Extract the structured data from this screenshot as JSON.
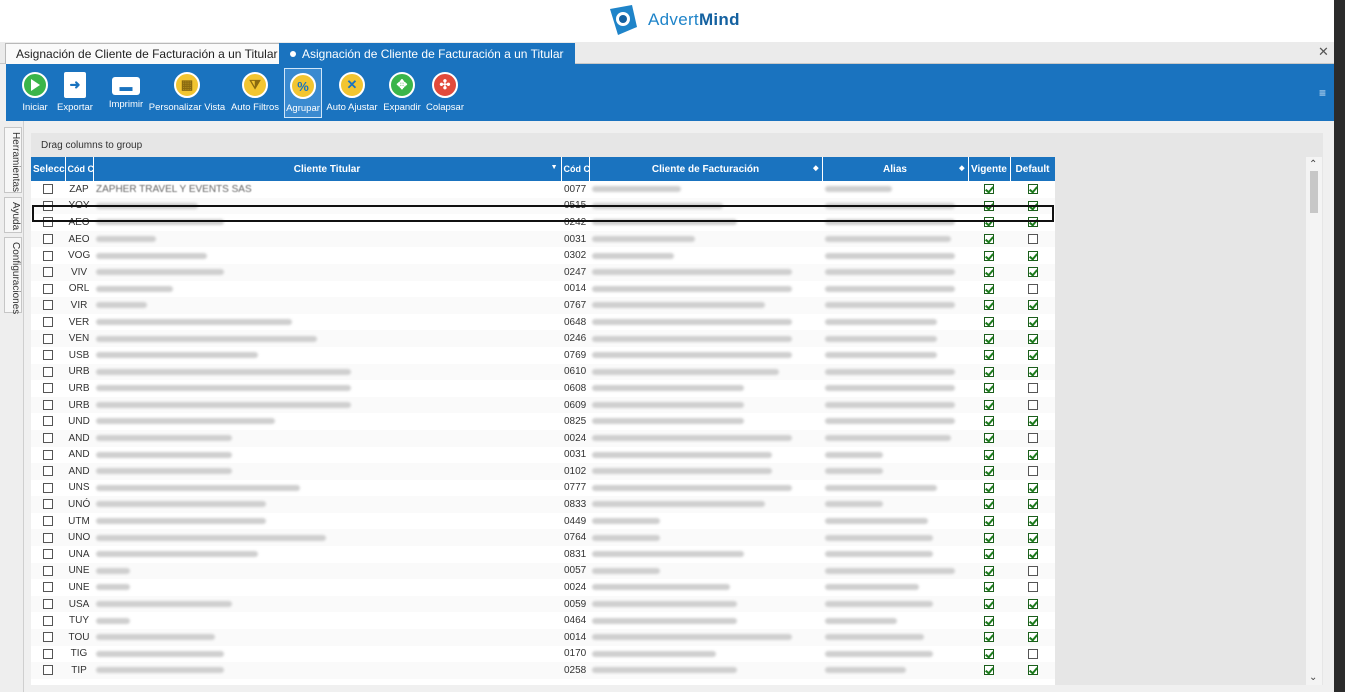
{
  "app": {
    "brand_part1": "Advert",
    "brand_part2": "Mind"
  },
  "tabs": [
    {
      "label": "Asignación de Cliente de Facturación a un Titular",
      "active": false
    },
    {
      "label": "Asignación de Cliente de Facturación a un Titular",
      "active": true
    }
  ],
  "toolbar": {
    "buttons": [
      {
        "label": "Iniciar",
        "icon": "play-icon",
        "color": "#3bb54a"
      },
      {
        "label": "Exportar",
        "icon": "export-icon",
        "color": "#ffffff"
      },
      {
        "label": "Imprimir",
        "icon": "printer-icon",
        "color": "#ffffff"
      },
      {
        "label": "Personalizar Vista",
        "icon": "grid-view-icon",
        "color": "#f2c531"
      },
      {
        "label": "Auto Filtros",
        "icon": "filter-icon",
        "color": "#f2c531"
      },
      {
        "label": "Agrupar",
        "icon": "group-icon",
        "color": "#f2c531"
      },
      {
        "label": "Auto Ajustar",
        "icon": "auto-fit-icon",
        "color": "#f2c531"
      },
      {
        "label": "Expandir",
        "icon": "expand-icon",
        "color": "#3bb54a"
      },
      {
        "label": "Colapsar",
        "icon": "collapse-icon",
        "color": "#e24a3b"
      }
    ]
  },
  "side_tabs": [
    "Herramientas",
    "Ayuda",
    "Configuraciones"
  ],
  "grid": {
    "group_hint": "Drag columns to group",
    "columns": [
      "Selecci",
      "Cód Cli Ti",
      "Cliente Titular",
      "Cód Cli F",
      "Cliente de Facturación",
      "Alias",
      "Vigente",
      "Default"
    ],
    "rows": [
      {
        "sel": false,
        "cod_tit": "ZAP",
        "titular": "ZAPHER TRAVEL Y EVENTS SAS",
        "cod_fac": "0077",
        "vig": true,
        "def": true
      },
      {
        "sel": false,
        "cod_tit": "YOY",
        "titular": "",
        "cod_fac": "0515",
        "vig": true,
        "def": true
      },
      {
        "sel": false,
        "cod_tit": "AEO",
        "titular": "",
        "cod_fac": "0242",
        "vig": true,
        "def": true
      },
      {
        "sel": false,
        "cod_tit": "AEO",
        "titular": "",
        "cod_fac": "0031",
        "vig": true,
        "def": false
      },
      {
        "sel": false,
        "cod_tit": "VOG",
        "titular": "",
        "cod_fac": "0302",
        "vig": true,
        "def": true
      },
      {
        "sel": false,
        "cod_tit": "VIV",
        "titular": "",
        "cod_fac": "0247",
        "vig": true,
        "def": true
      },
      {
        "sel": false,
        "cod_tit": "ORL",
        "titular": "",
        "cod_fac": "0014",
        "vig": true,
        "def": false
      },
      {
        "sel": false,
        "cod_tit": "VIR",
        "titular": "",
        "cod_fac": "0767",
        "vig": true,
        "def": true
      },
      {
        "sel": false,
        "cod_tit": "VER",
        "titular": "",
        "cod_fac": "0648",
        "vig": true,
        "def": true
      },
      {
        "sel": false,
        "cod_tit": "VEN",
        "titular": "",
        "cod_fac": "0246",
        "vig": true,
        "def": true
      },
      {
        "sel": false,
        "cod_tit": "USB",
        "titular": "",
        "cod_fac": "0769",
        "vig": true,
        "def": true
      },
      {
        "sel": false,
        "cod_tit": "URB",
        "titular": "",
        "cod_fac": "0610",
        "vig": true,
        "def": true
      },
      {
        "sel": false,
        "cod_tit": "URB",
        "titular": "",
        "cod_fac": "0608",
        "vig": true,
        "def": false
      },
      {
        "sel": false,
        "cod_tit": "URB",
        "titular": "",
        "cod_fac": "0609",
        "vig": true,
        "def": false
      },
      {
        "sel": false,
        "cod_tit": "UND",
        "titular": "",
        "cod_fac": "0825",
        "vig": true,
        "def": true
      },
      {
        "sel": false,
        "cod_tit": "AND",
        "titular": "",
        "cod_fac": "0024",
        "vig": true,
        "def": false
      },
      {
        "sel": false,
        "cod_tit": "AND",
        "titular": "",
        "cod_fac": "0031",
        "vig": true,
        "def": true
      },
      {
        "sel": false,
        "cod_tit": "AND",
        "titular": "",
        "cod_fac": "0102",
        "vig": true,
        "def": false
      },
      {
        "sel": false,
        "cod_tit": "UNS",
        "titular": "",
        "cod_fac": "0777",
        "vig": true,
        "def": true
      },
      {
        "sel": false,
        "cod_tit": "UNÓ",
        "titular": "",
        "cod_fac": "0833",
        "vig": true,
        "def": true
      },
      {
        "sel": false,
        "cod_tit": "UTM",
        "titular": "",
        "cod_fac": "0449",
        "vig": true,
        "def": true
      },
      {
        "sel": false,
        "cod_tit": "UNO",
        "titular": "",
        "cod_fac": "0764",
        "vig": true,
        "def": true
      },
      {
        "sel": false,
        "cod_tit": "UNA",
        "titular": "",
        "cod_fac": "0831",
        "vig": true,
        "def": true
      },
      {
        "sel": false,
        "cod_tit": "UNE",
        "titular": "",
        "cod_fac": "0057",
        "vig": true,
        "def": false
      },
      {
        "sel": false,
        "cod_tit": "UNE",
        "titular": "",
        "cod_fac": "0024",
        "vig": true,
        "def": false
      },
      {
        "sel": false,
        "cod_tit": "USA",
        "titular": "",
        "cod_fac": "0059",
        "vig": true,
        "def": true
      },
      {
        "sel": false,
        "cod_tit": "TUY",
        "titular": "",
        "cod_fac": "0464",
        "vig": true,
        "def": true
      },
      {
        "sel": false,
        "cod_tit": "TOU",
        "titular": "",
        "cod_fac": "0014",
        "vig": true,
        "def": true
      },
      {
        "sel": false,
        "cod_tit": "TIG",
        "titular": "",
        "cod_fac": "0170",
        "vig": true,
        "def": false
      },
      {
        "sel": false,
        "cod_tit": "TIP",
        "titular": "",
        "cod_fac": "0258",
        "vig": true,
        "def": true
      }
    ]
  }
}
